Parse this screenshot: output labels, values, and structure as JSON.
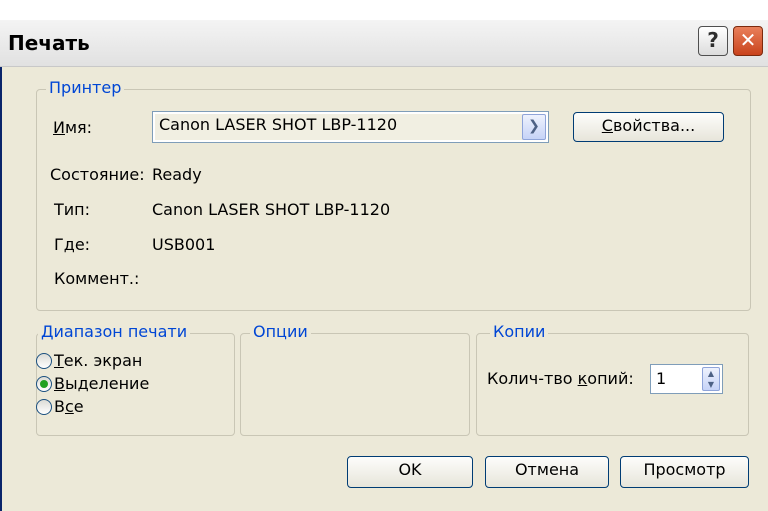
{
  "window": {
    "title": "Печать",
    "help_glyph": "?",
    "close_glyph": "✕"
  },
  "printer_group": {
    "legend": "Принтер",
    "name_label_accel": "И",
    "name_label_rest": "мя:",
    "name_value": "Canon LASER SHOT LBP-1120",
    "properties_accel": "С",
    "properties_rest": "войства...",
    "status_label": "Состояние:",
    "status_value": "Ready",
    "type_label": "Тип:",
    "type_value": "Canon LASER SHOT LBP-1120",
    "where_label": "Где:",
    "where_value": "USB001",
    "comment_label": "Коммент.:"
  },
  "range_group": {
    "legend": "Диапазон печати",
    "options": [
      {
        "accel": "Т",
        "rest": "ек. экран",
        "selected": false
      },
      {
        "accel": "В",
        "rest": "ыделение",
        "selected": true
      },
      {
        "prefix": "В",
        "accel": "с",
        "rest": "е",
        "selected": false
      }
    ]
  },
  "options_group": {
    "legend": "Опции"
  },
  "copies_group": {
    "legend": "Копии",
    "label_pre": "Колич-тво ",
    "label_accel": "к",
    "label_post": "опий:",
    "value": "1"
  },
  "buttons": {
    "ok": "OK",
    "cancel": "Отмена",
    "preview": "Просмотр"
  },
  "colors": {
    "legend_text": "#0046d5",
    "dialog_bg": "#ece9d8",
    "close_button": "#c9431c"
  }
}
